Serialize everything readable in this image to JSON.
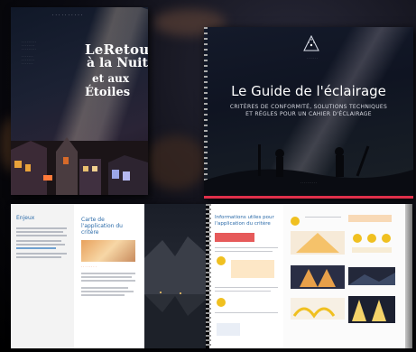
{
  "book_cover": {
    "title_line1": "LeRetour",
    "title_line2": "à la Nuit",
    "title_line3": "et aux",
    "title_line4": "Étoiles"
  },
  "guide_cover": {
    "title": "Le Guide de l'éclairage",
    "subtitle_line1": "CRITÈRES DE CONFORMITÉ, SOLUTIONS TECHNIQUES",
    "subtitle_line2": "ET RÉGLES POUR UN CAHIER D'ÉCLAIRAGE",
    "accent_color": "#e0304a"
  },
  "spread_left": {
    "page_a_heading": "Enjeux",
    "page_b_heading": "Carte de l'application du critère",
    "accent_color": "#2a6aa8"
  },
  "spread_right": {
    "page_d_heading": "Informations utiles pour l'application du critère",
    "highlight_color": "#e65a5a",
    "icon_color": "#f0c020"
  }
}
